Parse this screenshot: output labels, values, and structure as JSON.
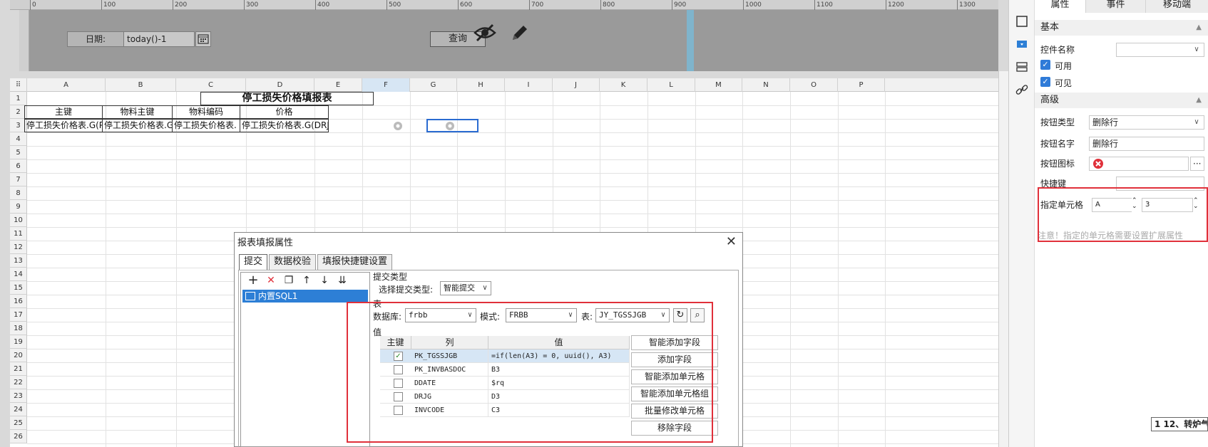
{
  "ruler": {
    "ticks": [
      "0",
      "100",
      "200",
      "300",
      "400",
      "500",
      "600",
      "700",
      "800",
      "900",
      "1000",
      "1100",
      "1200",
      "1300"
    ]
  },
  "params": {
    "date_label": "日期:",
    "date_value": "today()-1",
    "query_label": "查询"
  },
  "sheet": {
    "columns": [
      "A",
      "B",
      "C",
      "D",
      "E",
      "F",
      "G",
      "H",
      "I",
      "J",
      "K",
      "L",
      "M",
      "N",
      "O",
      "P"
    ],
    "selected_column": "F",
    "rows": [
      "1",
      "2",
      "3",
      "4",
      "5",
      "6",
      "7",
      "8",
      "9",
      "10",
      "11",
      "12",
      "13",
      "14",
      "15",
      "16",
      "17",
      "18",
      "19",
      "20",
      "21",
      "22",
      "23",
      "24",
      "25",
      "26"
    ],
    "title": "停工损失价格填报表",
    "headers": [
      "主键",
      "物料主键",
      "物料编码",
      "价格"
    ],
    "data_row": [
      "停工损失价格表.G(P",
      "停工损失价格表.G(",
      "停工损失价格表.",
      "停工损失价格表.G(DRJG"
    ]
  },
  "props": {
    "tabs": [
      "属性",
      "事件",
      "移动端"
    ],
    "basic_section": "基本",
    "control_name_label": "控件名称",
    "enabled_label": "可用",
    "visible_label": "可见",
    "advanced_section": "高级",
    "button_type_label": "按钮类型",
    "button_type_value": "删除行",
    "button_name_label": "按钮名字",
    "button_name_value": "删除行",
    "button_icon_label": "按钮图标",
    "hotkey_label": "快捷键",
    "cell_label": "指定单元格",
    "cell_col": "A",
    "cell_row": "3",
    "hint": "注意！指定的单元格需要设置扩展属性",
    "mini_tab": "1  12、转炉气"
  },
  "dialog": {
    "title": "报表填报属性",
    "tabs": [
      "提交",
      "数据校验",
      "填报快捷键设置"
    ],
    "tree_item": "内置SQL1",
    "submit_type_section": "提交类型",
    "select_type_label": "选择提交类型:",
    "select_type_value": "智能提交",
    "table_section": "表",
    "db_label": "数据库:",
    "db_value": "frbb",
    "schema_label": "模式:",
    "schema_value": "FRBB",
    "table_label": "表:",
    "table_value": "JY_TGSSJGB",
    "value_section": "值",
    "col_headers": [
      "主键",
      "列",
      "值"
    ],
    "rows": [
      {
        "key": true,
        "col": "PK_TGSSJGB",
        "val": "=if(len(A3) = 0, uuid(), A3)"
      },
      {
        "key": false,
        "col": "PK_INVBASDOC",
        "val": "B3"
      },
      {
        "key": false,
        "col": "DDATE",
        "val": "$rq"
      },
      {
        "key": false,
        "col": "DRJG",
        "val": "D3"
      },
      {
        "key": false,
        "col": "INVCODE",
        "val": "C3"
      }
    ],
    "buttons": [
      "智能添加字段",
      "添加字段",
      "智能添加单元格",
      "智能添加单元格组",
      "批量修改单元格",
      "移除字段"
    ]
  },
  "colors": {
    "accent": "#2d7fd6",
    "highlight": "#e0303a",
    "param_bg": "#9a9a9a"
  }
}
